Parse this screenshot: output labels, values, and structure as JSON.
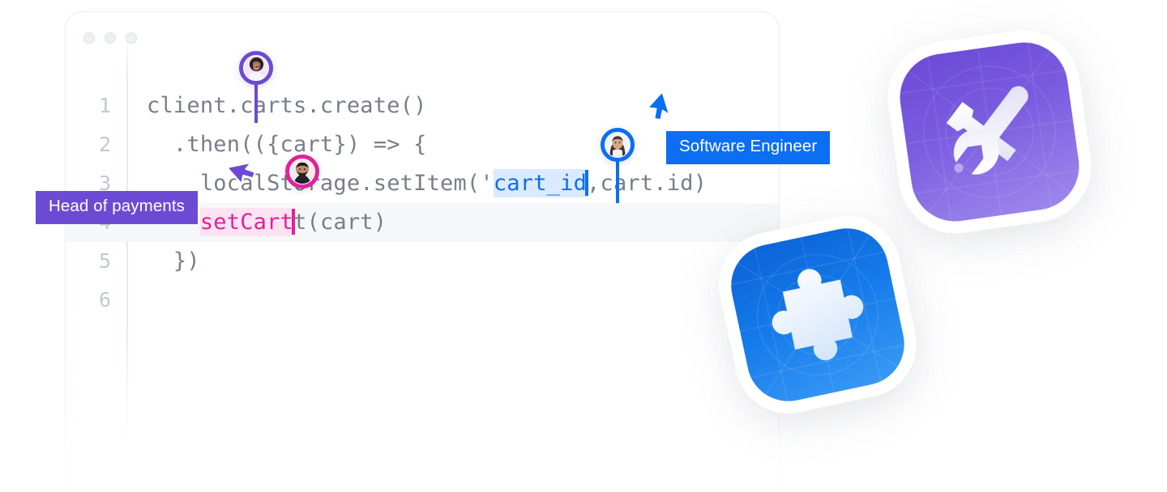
{
  "window": {
    "name": "code-editor-window",
    "traffic_lights": [
      "close",
      "minimize",
      "maximize"
    ]
  },
  "editor": {
    "language": "javascript",
    "lines": [
      {
        "number": "1",
        "indent": 0,
        "text": "client.carts.create()"
      },
      {
        "number": "2",
        "indent": 1,
        "text": ".then(({cart}) => {"
      },
      {
        "number": "3",
        "indent": 2,
        "text": "localStorage.setItem('cart_id',cart.id)"
      },
      {
        "number": "4",
        "indent": 2,
        "text": "setCart(cart)"
      },
      {
        "number": "5",
        "indent": 1,
        "text": "})"
      },
      {
        "number": "6",
        "indent": 0,
        "text": ""
      }
    ],
    "line1": {
      "number": "1",
      "text": "client.carts.create()"
    },
    "line2": {
      "number": "2",
      "text": "  .then(({cart}) => {"
    },
    "line3": {
      "number": "3",
      "prefix": "    localStorage.setItem('",
      "token": "cart_id",
      "suffix": ",cart.id)"
    },
    "line4": {
      "number": "4",
      "token": "setCart",
      "suffix": "t(cart)",
      "indent": "    "
    },
    "line5": {
      "number": "5",
      "text": "  })"
    },
    "line6": {
      "number": "6",
      "text": ""
    },
    "colors": {
      "code_text": "#787f88",
      "line_number": "#c3c8cf",
      "token_blue": "#0b6ef3",
      "token_blue_bg": "#dbeafe",
      "token_pink": "#e0219a",
      "token_pink_bg": "#fbe3f1",
      "active_line_bg": "#f6f7f8"
    }
  },
  "collaborators": [
    {
      "id": "collab-purple",
      "badge_label": "Head of payments",
      "color": "#6c4bd4",
      "avatar": "woman-curly-hair",
      "has_badge": true,
      "has_pointer": true
    },
    {
      "id": "collab-pink",
      "badge_label": "",
      "color": "#e0219a",
      "avatar": "man-beard",
      "has_badge": false,
      "has_pointer": false
    },
    {
      "id": "collab-blue",
      "badge_label": "Software Engineer",
      "color": "#0b6ef3",
      "avatar": "woman-long-hair",
      "has_badge": true,
      "has_pointer": true
    }
  ],
  "cursors": {
    "purple": {
      "label": "Head of payments",
      "color": "#6c4bd4"
    },
    "blue": {
      "label": "Software Engineer",
      "color": "#0b6ef3"
    },
    "pink": {
      "label": "",
      "color": "#e0219a"
    }
  },
  "app_icons": [
    {
      "id": "icon-tools",
      "icon": "tools-wrench-screwdriver-icon",
      "label": "",
      "color": "#7b5de0",
      "gradient_from": "#6a4ad6",
      "gradient_to": "#9f8aec"
    },
    {
      "id": "icon-puzzle",
      "icon": "puzzle-piece-icon",
      "label": "",
      "color": "#1479ea",
      "gradient_from": "#0b63d6",
      "gradient_to": "#3a9bf5"
    }
  ],
  "theme": {
    "background": "#ffffff",
    "window_border": "#e9ebee",
    "traffic_light": "#edeff1"
  }
}
